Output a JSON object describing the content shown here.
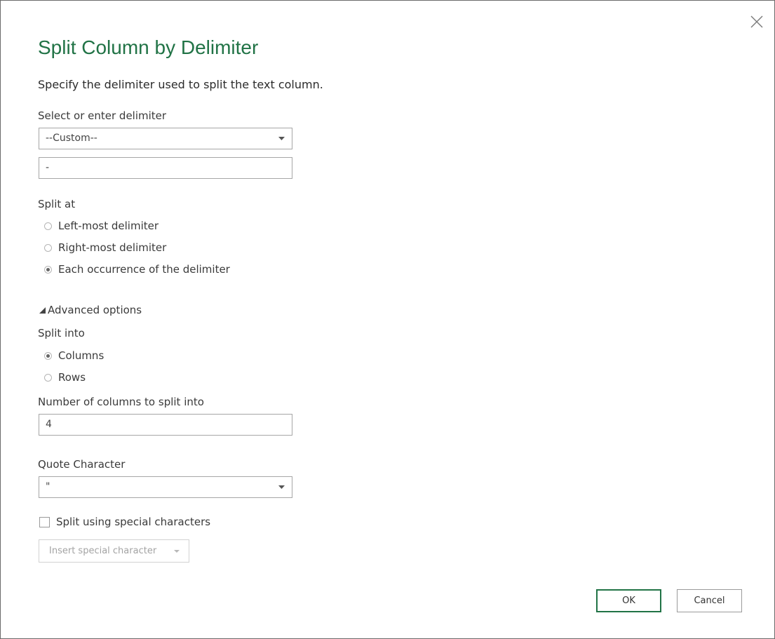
{
  "dialog": {
    "title": "Split Column by Delimiter",
    "subtitle": "Specify the delimiter used to split the text column."
  },
  "delimiter": {
    "label": "Select or enter delimiter",
    "selected": "--Custom--",
    "custom_value": "-"
  },
  "split_at": {
    "label": "Split at",
    "options": [
      {
        "label": "Left-most delimiter",
        "checked": false
      },
      {
        "label": "Right-most delimiter",
        "checked": false
      },
      {
        "label": "Each occurrence of the delimiter",
        "checked": true
      }
    ]
  },
  "advanced": {
    "toggle_label": "Advanced options",
    "expanded": true,
    "split_into": {
      "label": "Split into",
      "options": [
        {
          "label": "Columns",
          "checked": true
        },
        {
          "label": "Rows",
          "checked": false
        }
      ]
    },
    "num_columns": {
      "label": "Number of columns to split into",
      "value": "4"
    },
    "quote_char": {
      "label": "Quote Character",
      "selected": "\""
    },
    "special_chars": {
      "label": "Split using special characters",
      "checked": false
    },
    "insert_special": {
      "label": "Insert special character",
      "enabled": false
    }
  },
  "buttons": {
    "ok": "OK",
    "cancel": "Cancel"
  },
  "colors": {
    "title": "#217346",
    "ok_border": "#217346"
  }
}
